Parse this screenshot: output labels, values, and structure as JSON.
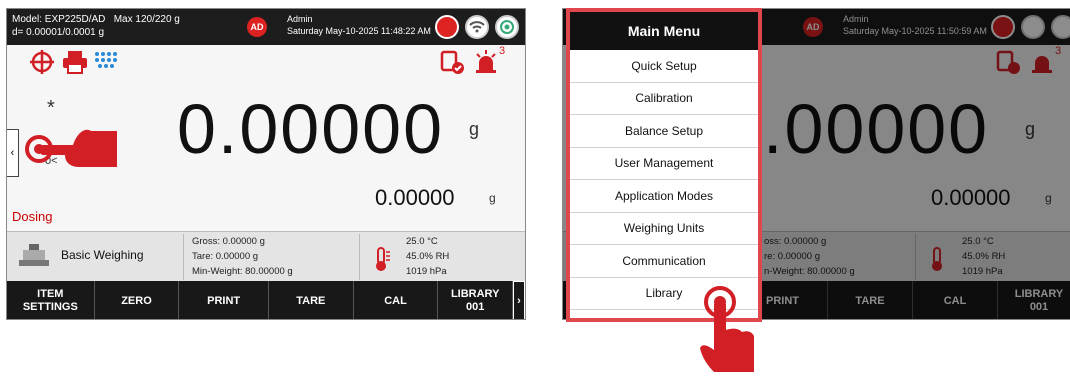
{
  "left_screen": {
    "model_line1": "Model: EXP225D/AD   Max 120/220 g",
    "model_line2": "d= 0.00001/0.0001 g",
    "user_badge": "AD",
    "user_name": "Admin",
    "datetime": "Saturday May-10-2025 11:48:22 AM",
    "alarm_count": "3",
    "primary_value": "0.00000",
    "primary_unit": "g",
    "secondary_value": "0.00000",
    "secondary_unit": "g",
    "asterisk": "*",
    "status": "Dosing",
    "zero_label": "0<"
  },
  "right_screen": {
    "user_badge": "AD",
    "user_name": "Admin",
    "datetime": "Saturday May-10-2025 11:50:59 AM",
    "alarm_count": "3",
    "primary_value": "00000",
    "primary_unit": "g",
    "secondary_value": "0.00000",
    "secondary_unit": "g"
  },
  "info": {
    "mode": "Basic Weighing",
    "gross": "Gross: 0.00000 g",
    "tare": "Tare: 0.00000 g",
    "min_weight": "Min-Weight: 80.00000 g",
    "temp": "25.0 °C",
    "humidity": "45.0% RH",
    "pressure": "1019 hPa"
  },
  "info_right": {
    "gross": "oss: 0.00000 g",
    "tare": "re: 0.00000 g",
    "min_weight": "n-Weight: 80.00000 g",
    "temp": "25.0 °C",
    "humidity": "45.0% RH",
    "pressure": "1019 hPa"
  },
  "buttons": {
    "item_settings": "ITEM\nSETTINGS",
    "zero": "ZERO",
    "print": "PRINT",
    "tare": "TARE",
    "cal": "CAL",
    "library": "LIBRARY\n001"
  },
  "buttons_right": {
    "print": "PRINT",
    "tare": "TARE",
    "cal": "CAL",
    "library": "LIBRARY\n001"
  },
  "menu": {
    "title": "Main Menu",
    "items": [
      "Quick Setup",
      "Calibration",
      "Balance Setup",
      "User Management",
      "Application Modes",
      "Weighing Units",
      "Communication",
      "Library"
    ]
  },
  "colors": {
    "accent": "#d21f26",
    "highlight": "#e0474c"
  },
  "icons": [
    "target-icon",
    "printer-icon",
    "keypad-icon",
    "clipboard-check-icon",
    "alarm-icon",
    "usb-icon",
    "wifi-icon",
    "record-icon",
    "hand-pointer-icon",
    "thermometer-icon",
    "balance-icon"
  ]
}
